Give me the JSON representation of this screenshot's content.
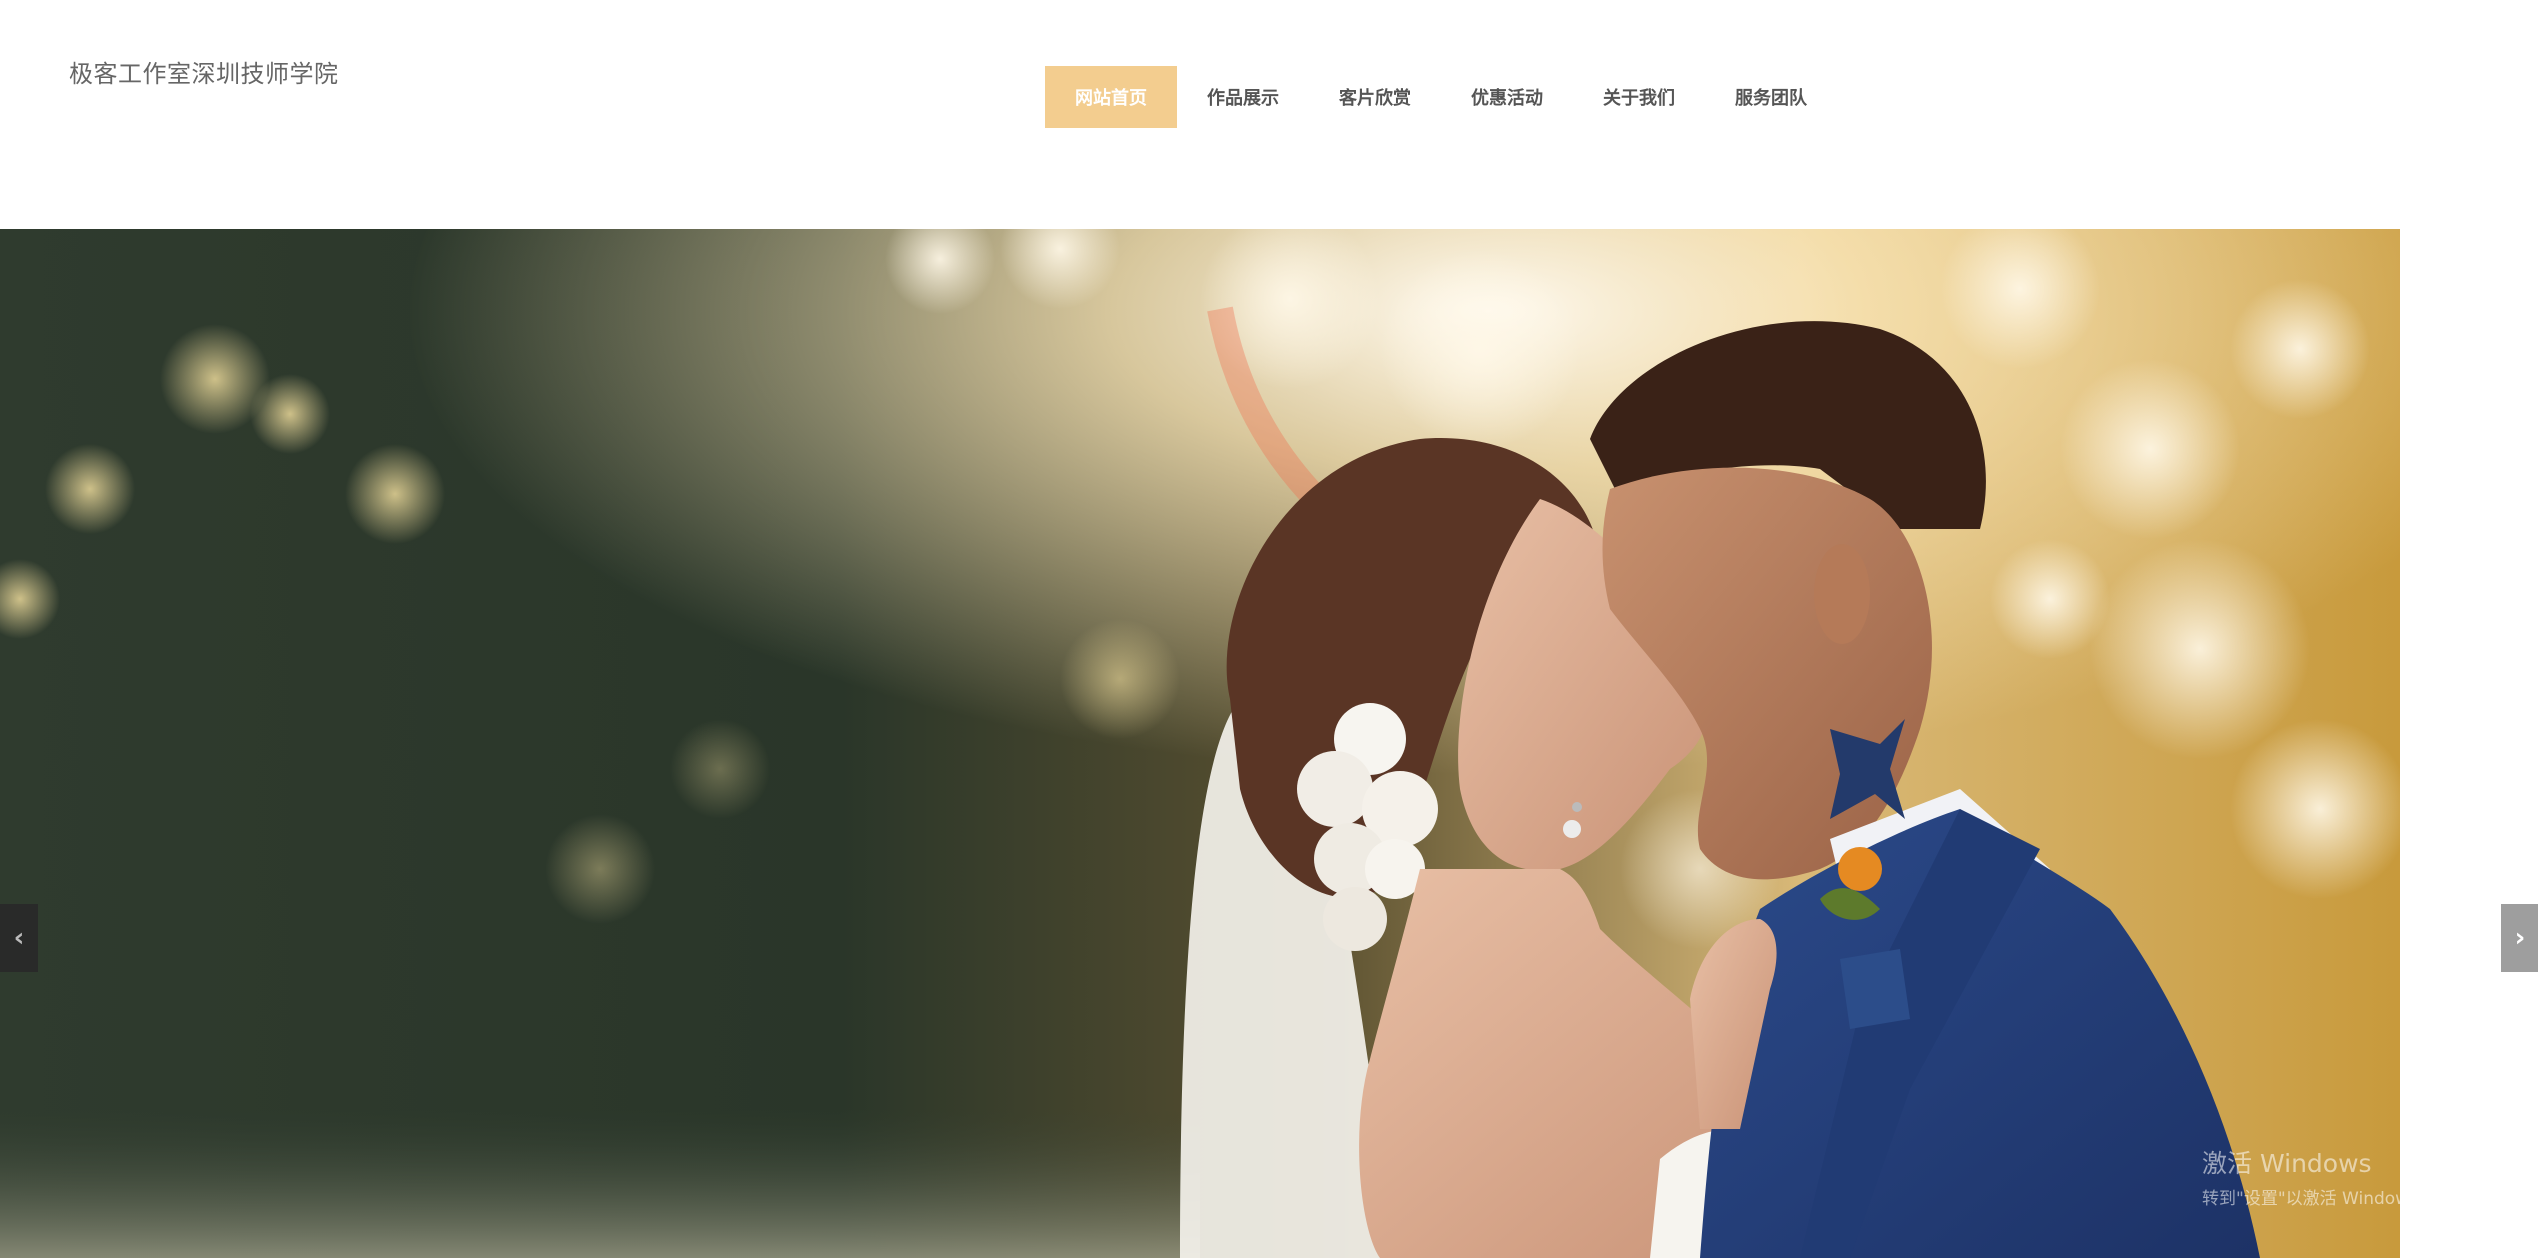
{
  "header": {
    "site_title": "极客工作室深圳技师学院"
  },
  "nav": {
    "items": [
      {
        "label": "网站首页",
        "active": true
      },
      {
        "label": "作品展示"
      },
      {
        "label": "客片欣赏"
      },
      {
        "label": "优惠活动"
      },
      {
        "label": "关于我们"
      },
      {
        "label": "服务团队"
      }
    ]
  },
  "slider": {
    "prev_glyph": "‹",
    "next_glyph": "›",
    "image_semantic": "wedding-couple-photo"
  },
  "watermark": {
    "title": "激活 Windows",
    "subtitle": "转到\"设置\"以激活 Windows。"
  },
  "colors": {
    "accent": "#f3cd8f",
    "nav_text": "#555555",
    "title_text": "#666666"
  }
}
